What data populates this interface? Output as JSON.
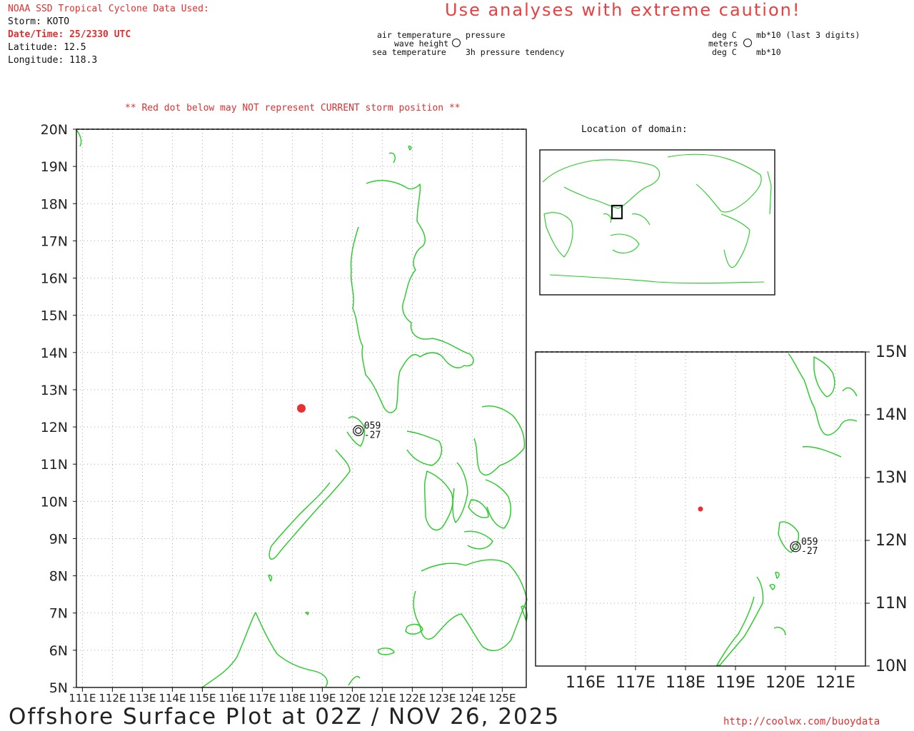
{
  "header": {
    "source": "NOAA SSD Tropical Cyclone Data Used:",
    "storm": "Storm: KOTO",
    "datetime": "Date/Time: 25/2330 UTC",
    "latitude": "Latitude: 12.5",
    "longitude": "Longitude: 118.3"
  },
  "caution": "Use analyses with extreme caution!",
  "legend": {
    "left": {
      "air_temperature": "air temperature",
      "wave_height": "wave height",
      "sea_temperature": "sea temperature",
      "pressure": "pressure",
      "pressure_tendency": "3h pressure tendency"
    },
    "right": {
      "deg_c_top": "deg C",
      "meters": "meters",
      "deg_c_bottom": "deg C",
      "mb_last3": "mb*10 (last 3 digits)",
      "mb10": "mb*10"
    }
  },
  "warning": "** Red dot below may NOT represent CURRENT storm position **",
  "inset_title": "Location of domain:",
  "main_map": {
    "lat_labels": [
      "20N",
      "19N",
      "18N",
      "17N",
      "16N",
      "15N",
      "14N",
      "13N",
      "12N",
      "11N",
      "10N",
      "9N",
      "8N",
      "7N",
      "6N",
      "5N"
    ],
    "lon_labels": [
      "111E",
      "112E",
      "113E",
      "114E",
      "115E",
      "116E",
      "117E",
      "118E",
      "119E",
      "120E",
      "121E",
      "122E",
      "123E",
      "124E",
      "125E"
    ],
    "lat_range": [
      5,
      20
    ],
    "lon_range": [
      110.8,
      125.8
    ]
  },
  "zoom_map": {
    "lat_labels": [
      "15N",
      "14N",
      "13N",
      "12N",
      "11N",
      "10N"
    ],
    "lon_labels": [
      "116E",
      "117E",
      "118E",
      "119E",
      "120E",
      "121E"
    ],
    "lat_range": [
      10,
      15
    ],
    "lon_range": [
      115.0,
      121.6
    ]
  },
  "storm": {
    "lat": 12.5,
    "lon": 118.3,
    "color": "#e83030"
  },
  "station": {
    "lat": 11.9,
    "lon": 120.2,
    "pressure": "059",
    "tendency": "-27"
  },
  "colors": {
    "coast": "#22cc22",
    "storm": "#e83030",
    "grid": "#999999"
  },
  "footer": {
    "title": "Offshore Surface Plot at 02Z / NOV 26, 2025",
    "url": "http://coolwx.com/buoydata"
  }
}
